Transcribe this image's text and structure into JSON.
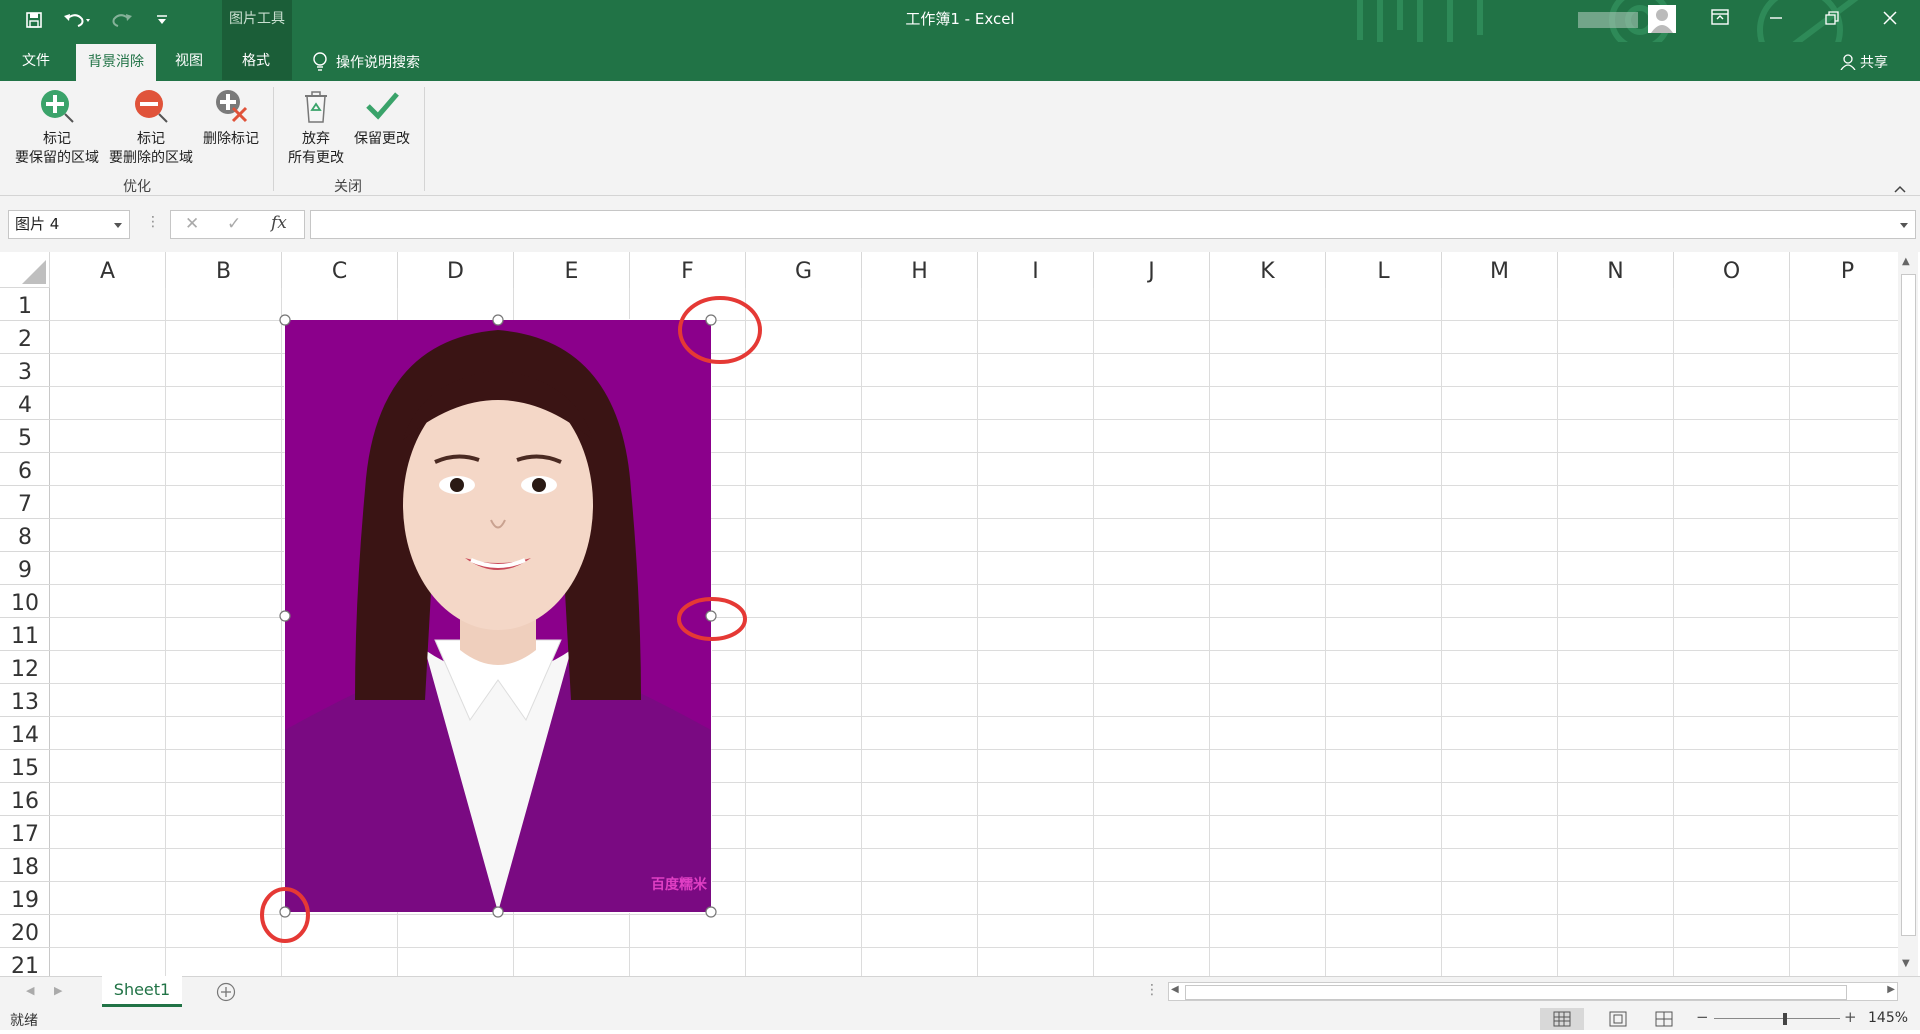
{
  "window": {
    "title": "工作簿1  -  Excel",
    "context_tools": "图片工具",
    "share": "共享"
  },
  "tabs": [
    "文件",
    "背景消除",
    "视图",
    "格式"
  ],
  "tell_me": "操作说明搜索",
  "ribbon": {
    "groups": [
      {
        "label": "优化",
        "buttons": [
          {
            "line1": "标记",
            "line2": "要保留的区域"
          },
          {
            "line1": "标记",
            "line2": "要删除的区域"
          },
          {
            "line1": "删除标记",
            "line2": ""
          }
        ]
      },
      {
        "label": "关闭",
        "buttons": [
          {
            "line1": "放弃",
            "line2": "所有更改"
          },
          {
            "line1": "保留更改",
            "line2": ""
          }
        ]
      }
    ]
  },
  "formula_bar": {
    "name_box": "图片 4",
    "cancel": "✕",
    "enter": "✓",
    "fx": "fx",
    "value": ""
  },
  "columns": [
    "A",
    "B",
    "C",
    "D",
    "E",
    "F",
    "G",
    "H",
    "I",
    "J",
    "K",
    "L",
    "M",
    "N",
    "O",
    "P"
  ],
  "rows": [
    "1",
    "2",
    "3",
    "4",
    "5",
    "6",
    "7",
    "8",
    "9",
    "10",
    "11",
    "12",
    "13",
    "14",
    "15",
    "16",
    "17",
    "18",
    "19",
    "20",
    "21"
  ],
  "picture": {
    "watermark": "百度糯米"
  },
  "sheets": [
    "Sheet1"
  ],
  "status": {
    "ready": "就绪",
    "zoom": "145%"
  },
  "colors": {
    "excel_green": "#217346",
    "picture_bg": "#8b008b",
    "annotation": "#e53935"
  }
}
